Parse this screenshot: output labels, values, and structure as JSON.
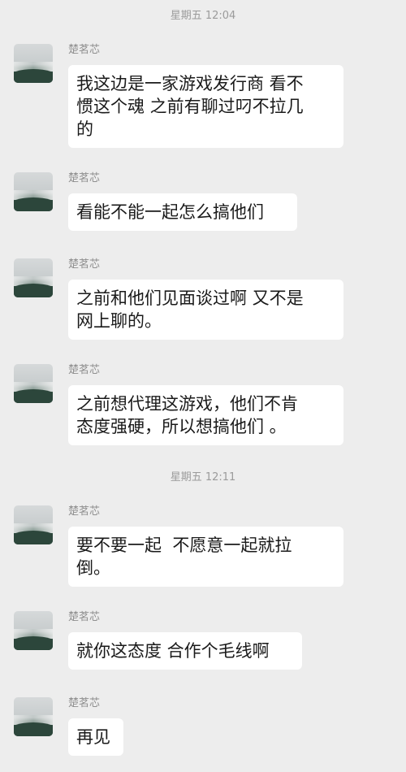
{
  "timestamps": [
    {
      "text": "星期五 12:04"
    },
    {
      "text": "星期五 12:11"
    }
  ],
  "messages": [
    {
      "sender": "楚茗芯",
      "text": "我这边是一家游戏发行商 看不\n惯这个魂 之前有聊过叼不拉几\n的"
    },
    {
      "sender": "楚茗芯",
      "text": "看能不能一起怎么搞他们"
    },
    {
      "sender": "楚茗芯",
      "text": "之前和他们见面谈过啊 又不是\n网上聊的。"
    },
    {
      "sender": "楚茗芯",
      "text": "之前想代理这游戏，他们不肯\n态度强硬，所以想搞他们 。"
    },
    {
      "sender": "楚茗芯",
      "text": "要不要一起  不愿意一起就拉\n倒。"
    },
    {
      "sender": "楚茗芯",
      "text": "就你这态度 合作个毛线啊"
    },
    {
      "sender": "楚茗芯",
      "text": "再见"
    }
  ],
  "colors": {
    "background": "#ededed",
    "bubble": "#ffffff",
    "sender_text": "#8f8f8f",
    "timestamp_text": "#9b9b9b"
  },
  "icons": {
    "avatar": "misty-landscape-avatar-icon"
  }
}
